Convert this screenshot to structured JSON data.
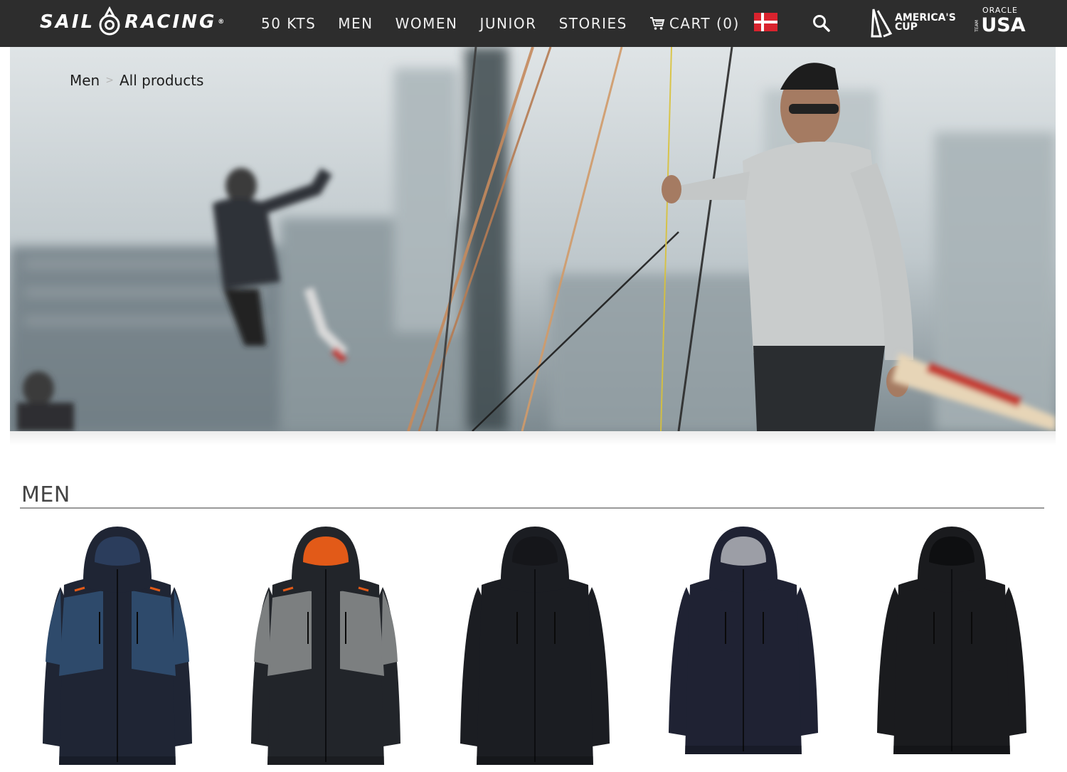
{
  "brand": {
    "logo_text_left": "SAIL",
    "logo_text_right": "RACING",
    "registered_mark": "®"
  },
  "nav": {
    "items": [
      {
        "label": "50 KTS"
      },
      {
        "label": "MEN"
      },
      {
        "label": "WOMEN"
      },
      {
        "label": "JUNIOR"
      },
      {
        "label": "STORIES"
      }
    ],
    "cart_label": "CART (0)",
    "flag": "denmark-flag-icon",
    "search_icon": "search-icon"
  },
  "partners": {
    "americas_cup_line1": "AMERICA'S",
    "americas_cup_line2": "CUP",
    "oracle_top": "ORACLE",
    "oracle_team": "TEAM",
    "oracle_usa": "USA"
  },
  "breadcrumb": {
    "items": [
      {
        "label": "Men"
      },
      {
        "label": "All products"
      }
    ],
    "separator": ">"
  },
  "section": {
    "title": "MEN"
  },
  "products": [
    {
      "name": "navy-blue-parka",
      "body_color": "#1f2534",
      "panel_color": "#2e4a6b",
      "hood_lining": "#2b3d5c"
    },
    {
      "name": "grey-orange-parka",
      "body_color": "#22252a",
      "panel_color": "#7c7f80",
      "hood_lining": "#e25a18"
    },
    {
      "name": "black-parka",
      "body_color": "#1b1d22",
      "panel_color": "#1b1d22",
      "hood_lining": "#15161a"
    },
    {
      "name": "navy-down-jacket",
      "body_color": "#1f2233",
      "panel_color": "#1f2233",
      "hood_lining": "#9c9ea6"
    },
    {
      "name": "black-down-jacket",
      "body_color": "#1a1b1e",
      "panel_color": "#1a1b1e",
      "hood_lining": "#0e0f11"
    }
  ],
  "colors": {
    "nav_bg": "#2d2d2d",
    "nav_text": "#f0f0f0",
    "accent_orange": "#e25a18"
  }
}
